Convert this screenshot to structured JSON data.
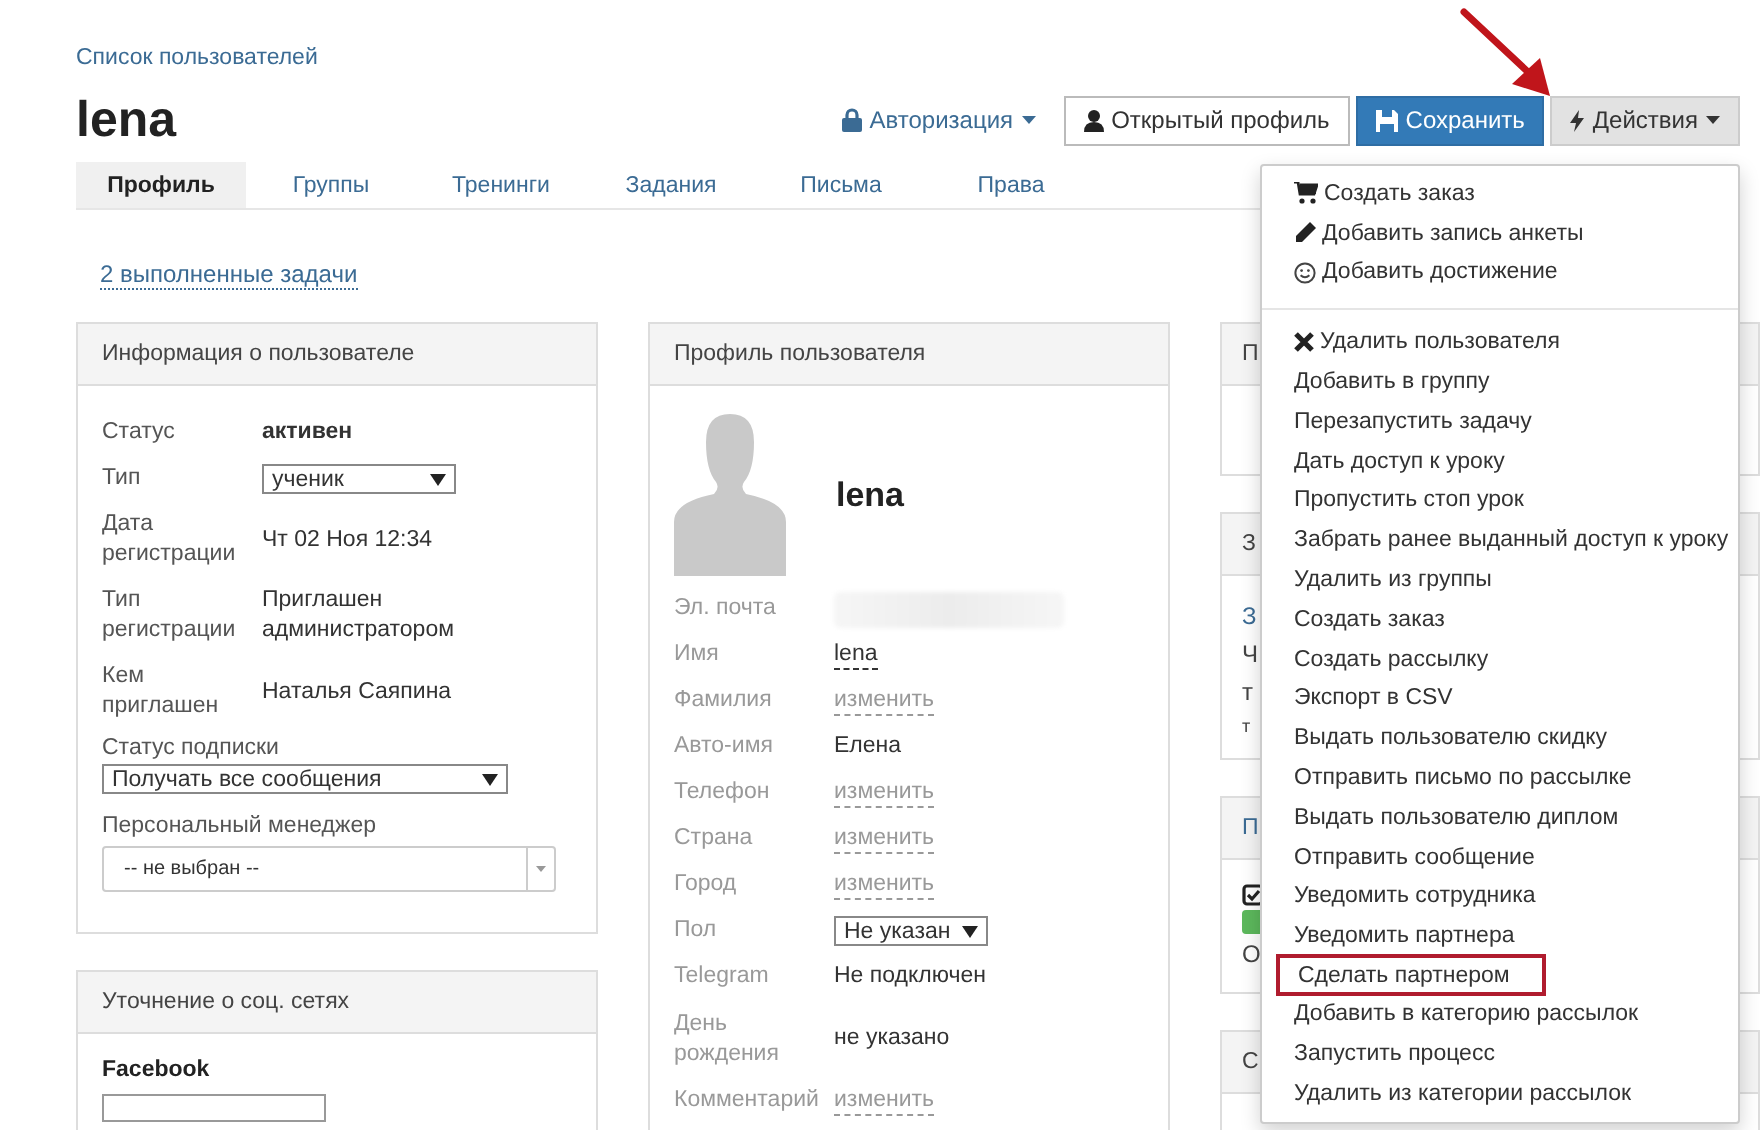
{
  "breadcrumb": "Список пользователей",
  "title": "lena",
  "header_actions": {
    "auth": "Авторизация",
    "open_profile": "Открытый профиль",
    "save": "Сохранить",
    "actions": "Действия"
  },
  "tabs": [
    {
      "label": "Профиль",
      "selected": true
    },
    {
      "label": "Группы",
      "selected": false
    },
    {
      "label": "Тренинги",
      "selected": false
    },
    {
      "label": "Задания",
      "selected": false
    },
    {
      "label": "Письма",
      "selected": false
    },
    {
      "label": "Права",
      "selected": false
    }
  ],
  "tasks_link": "2 выполненные задачи",
  "user_info": {
    "title": "Информация о пользователе",
    "rows": [
      {
        "kind": "strong",
        "label": "Статус",
        "value": "активен"
      },
      {
        "kind": "select",
        "label": "Тип",
        "value": "ученик"
      },
      {
        "kind": "text",
        "label": "Дата регистрации",
        "value": "Чт 02 Ноя 12:34"
      },
      {
        "kind": "text",
        "label": "Тип регистрации",
        "value": "Приглашен администратором"
      },
      {
        "kind": "text",
        "label": "Кем приглашен",
        "value": "Наталья Саяпина"
      }
    ],
    "subscription": {
      "label": "Статус подписки",
      "value": "Получать все сообщения"
    },
    "manager": {
      "label": "Персональный менеджер",
      "value": "-- не выбран --"
    }
  },
  "social": {
    "title": "Уточнение о соц. сетях",
    "network": "Facebook"
  },
  "profile": {
    "title": "Профиль пользователя",
    "name": "lena",
    "rows": [
      {
        "kind": "blurred",
        "label": "Эл. почта"
      },
      {
        "kind": "dashed",
        "label": "Имя",
        "value": "lena"
      },
      {
        "kind": "link",
        "label": "Фамилия",
        "value": "изменить"
      },
      {
        "kind": "text",
        "label": "Авто-имя",
        "value": "Елена"
      },
      {
        "kind": "link",
        "label": "Телефон",
        "value": "изменить"
      },
      {
        "kind": "link",
        "label": "Страна",
        "value": "изменить"
      },
      {
        "kind": "link",
        "label": "Город",
        "value": "изменить"
      },
      {
        "kind": "select",
        "label": "Пол",
        "value": "Не указан"
      },
      {
        "kind": "text",
        "label": "Telegram",
        "value": "Не подключен"
      },
      {
        "kind": "text",
        "label": "День рождения",
        "value": "не указано"
      },
      {
        "kind": "link",
        "label": "Комментарий",
        "value": "изменить"
      }
    ]
  },
  "side_panels": [
    {
      "title": "П",
      "title_link": false
    },
    {
      "title": "З",
      "title_link": false,
      "lines": [
        {
          "kind": "link",
          "text": "З"
        },
        {
          "kind": "text",
          "text": "Ч"
        },
        {
          "kind": "text",
          "text": "т"
        },
        {
          "kind": "small",
          "text": "т"
        }
      ]
    },
    {
      "title": "П",
      "title_link": true,
      "lines": [
        {
          "kind": "checkbox"
        },
        {
          "kind": "badge"
        },
        {
          "kind": "text",
          "text": "О"
        }
      ]
    },
    {
      "title": "С",
      "title_link": false
    }
  ],
  "actions_menu": {
    "groups": [
      [
        {
          "label": "Создать заказ",
          "highlighted": false
        },
        {
          "label": "Добавить запись анкеты",
          "highlighted": false
        },
        {
          "label": "Добавить достижение",
          "highlighted": false
        }
      ],
      [
        {
          "label": "Удалить пользователя",
          "highlighted": false
        },
        {
          "label": "Добавить в группу",
          "highlighted": false
        },
        {
          "label": "Перезапустить задачу",
          "highlighted": false
        },
        {
          "label": "Дать доступ к уроку",
          "highlighted": false
        },
        {
          "label": "Пропустить стоп урок",
          "highlighted": false
        },
        {
          "label": "Забрать ранее выданный доступ к уроку",
          "highlighted": false
        },
        {
          "label": "Удалить из группы",
          "highlighted": false
        },
        {
          "label": "Создать заказ",
          "highlighted": false
        },
        {
          "label": "Создать рассылку",
          "highlighted": false
        },
        {
          "label": "Экспорт в CSV",
          "highlighted": false
        },
        {
          "label": "Выдать пользователю скидку",
          "highlighted": false
        },
        {
          "label": "Отправить письмо по рассылке",
          "highlighted": false
        },
        {
          "label": "Выдать пользователю диплом",
          "highlighted": false
        },
        {
          "label": "Отправить сообщение",
          "highlighted": false
        },
        {
          "label": "Уведомить сотрудника",
          "highlighted": false
        },
        {
          "label": "Уведомить партнера",
          "highlighted": false
        },
        {
          "label": "Сделать партнером",
          "highlighted": true
        },
        {
          "label": "Добавить в категорию рассылок",
          "highlighted": false
        },
        {
          "label": "Запустить процесс",
          "highlighted": false
        },
        {
          "label": "Удалить из категории рассылок",
          "highlighted": false
        }
      ]
    ]
  }
}
